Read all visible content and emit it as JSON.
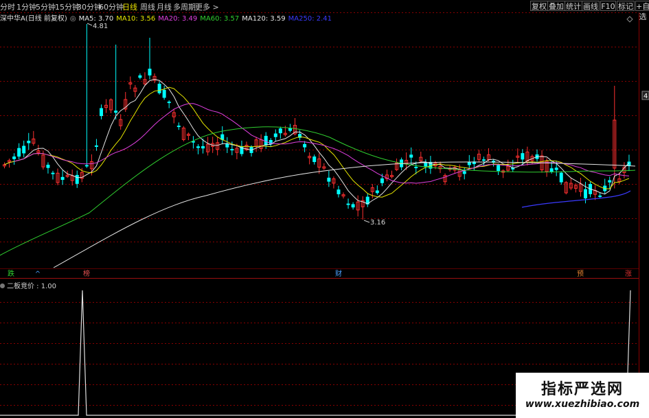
{
  "toolbar": {
    "periods": [
      {
        "label": "分时",
        "active": false
      },
      {
        "label": "1分钟",
        "active": false
      },
      {
        "label": "5分钟",
        "active": false
      },
      {
        "label": "15分钟",
        "active": false
      },
      {
        "label": "30分钟",
        "active": false
      },
      {
        "label": "60分钟",
        "active": false
      },
      {
        "label": "日线",
        "active": true
      },
      {
        "label": "周线",
        "active": false
      },
      {
        "label": "月线",
        "active": false
      },
      {
        "label": "多周期",
        "active": false
      },
      {
        "label": "更多 >",
        "active": false
      }
    ],
    "buttons": [
      "复权",
      "叠加",
      "统计",
      "画线",
      "F10",
      "标记",
      "+自选"
    ]
  },
  "ma_bar": {
    "title": "深中华A(日线 前复权)",
    "items": [
      {
        "text": "MA5: 3.70",
        "color": "#e6e6e6"
      },
      {
        "text": "MA10: 3.56",
        "color": "#e6e600"
      },
      {
        "text": "MA20: 3.49",
        "color": "#e040e0"
      },
      {
        "text": "MA60: 3.57",
        "color": "#30d030"
      },
      {
        "text": "MA120: 3.59",
        "color": "#e6e6e6"
      },
      {
        "text": "MA250: 2.41",
        "color": "#3a3aff"
      }
    ]
  },
  "annotations": {
    "high": "4.81",
    "low": "3.16",
    "right_tag": "4"
  },
  "signals": [
    {
      "text": "跌",
      "color": "#30d030"
    },
    {
      "text": "^",
      "color": "#4aa0ff"
    },
    {
      "text": "榜",
      "color": "#e05050"
    },
    {
      "text": "财",
      "color": "#4aa0ff"
    },
    {
      "text": "预",
      "color": "#e08030"
    },
    {
      "text": "涨",
      "color": "#e03030"
    }
  ],
  "indicator": {
    "title": "二板竞价 : 1.00"
  },
  "watermark": {
    "title": "指标严选网",
    "url": "www.xuezhibiao.com"
  },
  "colors": {
    "up": "#ff3030",
    "down": "#00ffff",
    "grid": "#8b0000",
    "ma5": "#e6e6e6",
    "ma10": "#e6e600",
    "ma20": "#e040e0",
    "ma60": "#30d030",
    "ma120": "#e6e6e6",
    "ma250": "#3a3aff"
  },
  "chart_data": {
    "type": "candlestick",
    "price_labels": {
      "max": 4.81,
      "min": 3.16
    },
    "indicator_series": {
      "name": "二板竞价",
      "spikes": 2,
      "value": 1.0
    }
  }
}
